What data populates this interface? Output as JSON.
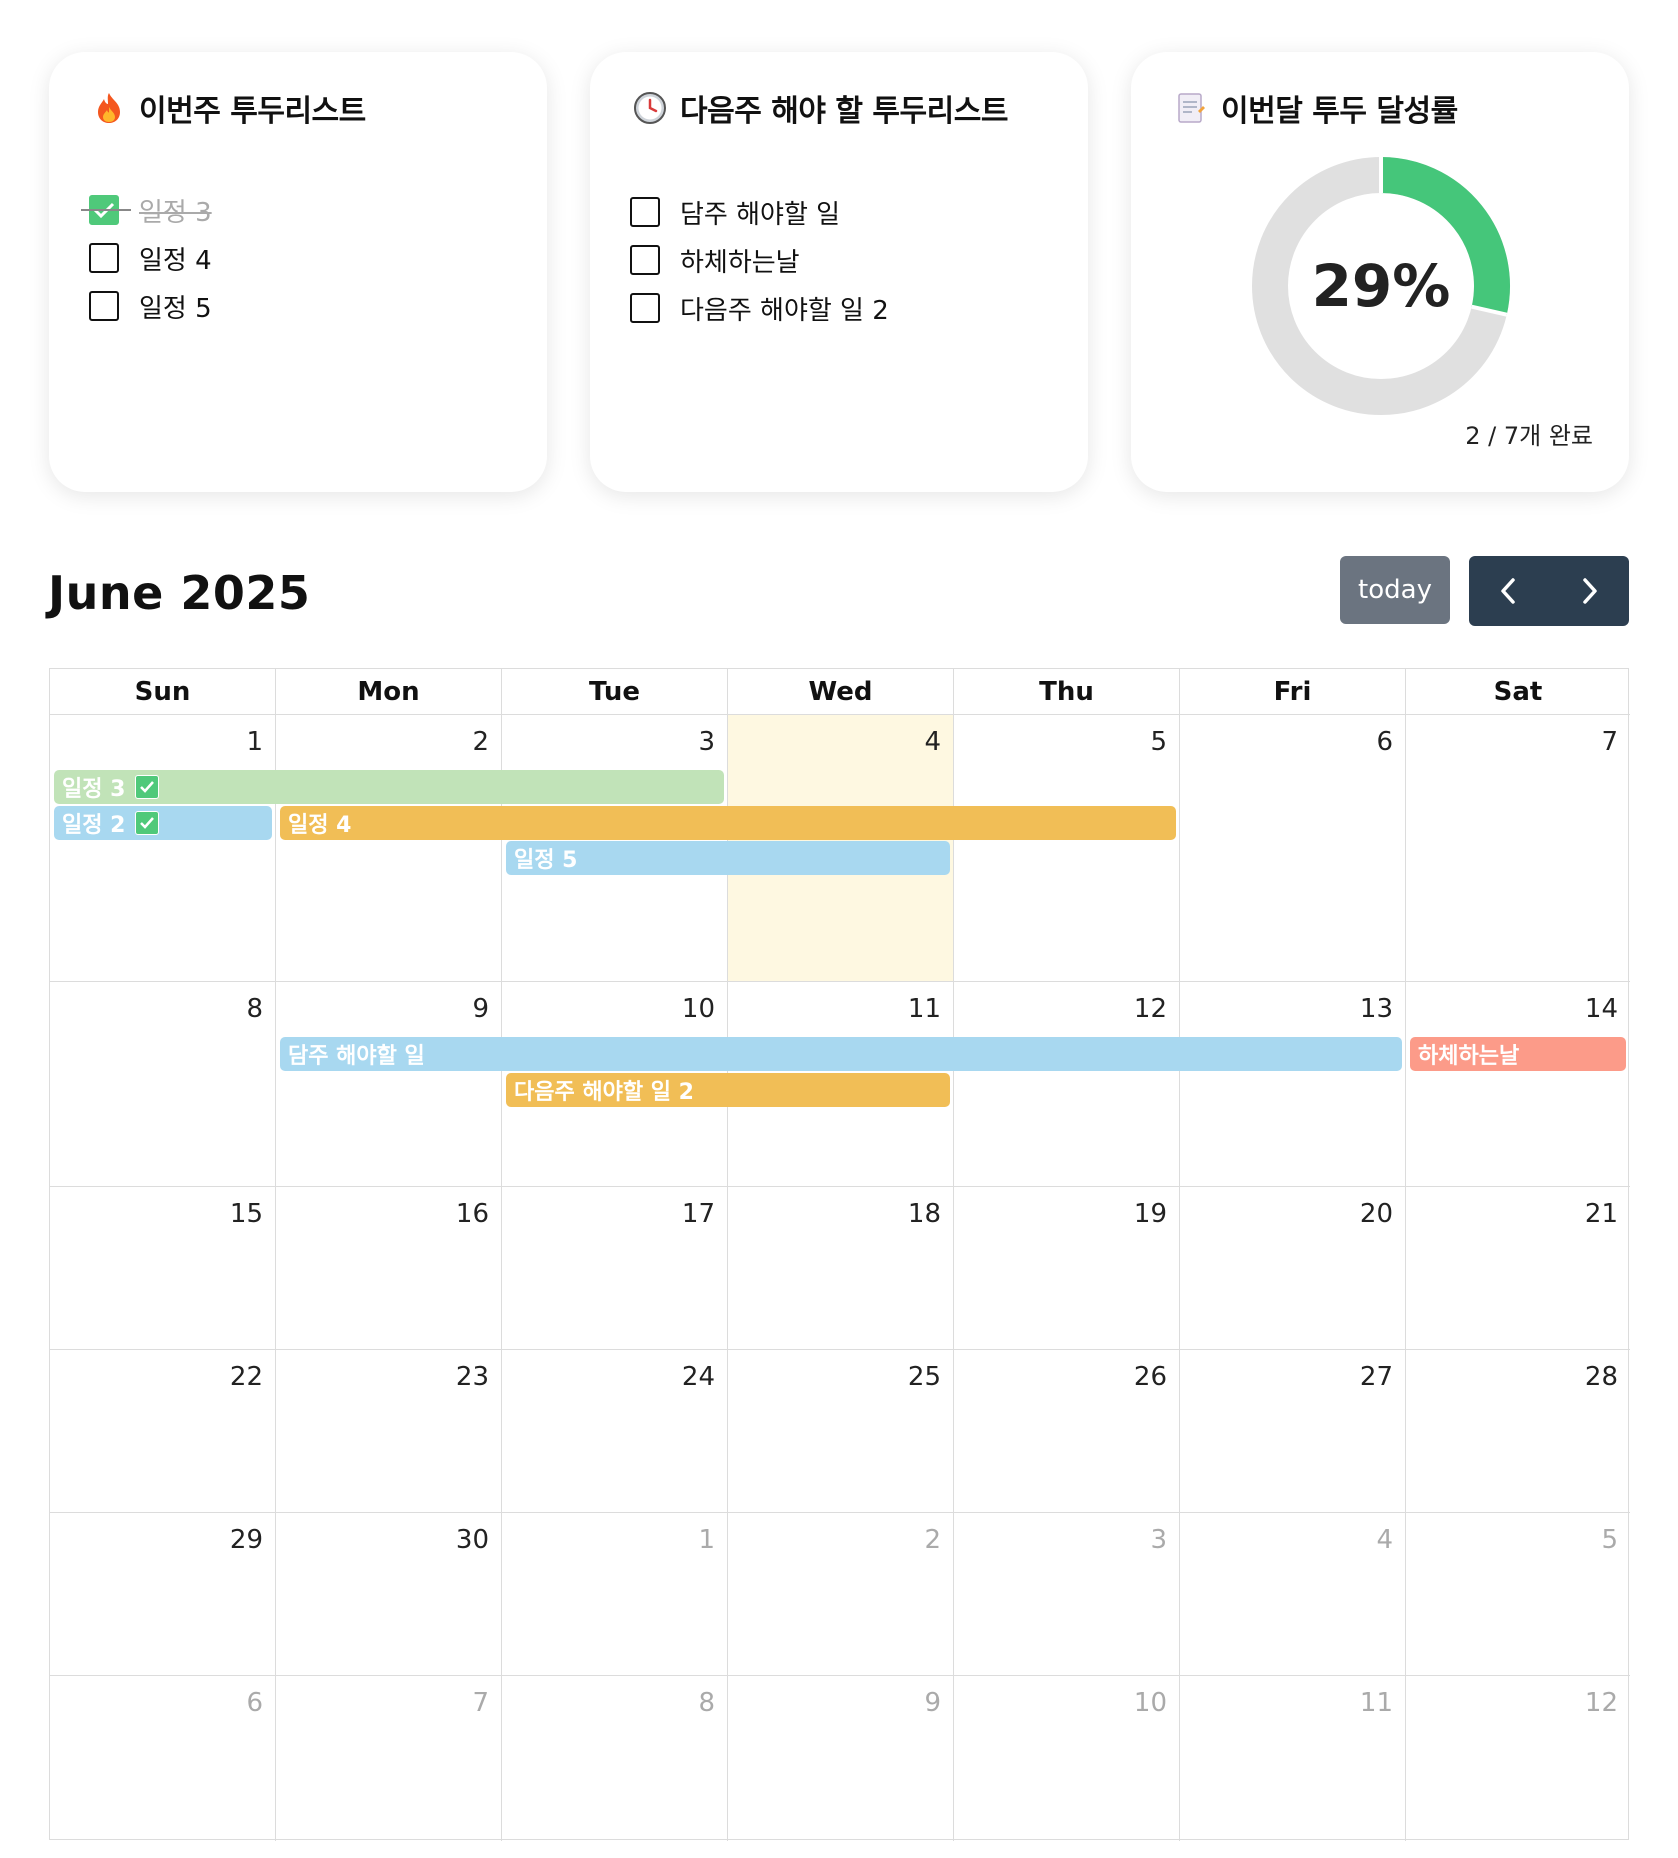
{
  "colors": {
    "card_shadow": "rgba(0,0,0,0.10)",
    "check_green": "#4fc97a",
    "donut_fill": "#45c67a",
    "donut_track": "#e0e0e0",
    "today_bg": "#fef8e1",
    "btn_today": "#6b7480",
    "btn_nav": "#2c3e50",
    "event_green": "#c1e3b8",
    "event_blue": "#a8d8f0",
    "event_orange": "#f1be56",
    "event_salmon": "#fc9b89"
  },
  "cards": {
    "this_week": {
      "icon": "fire-icon",
      "title": "이번주 투두리스트",
      "items": [
        {
          "label": "일정 3",
          "done": true
        },
        {
          "label": "일정 4",
          "done": false
        },
        {
          "label": "일정 5",
          "done": false
        }
      ]
    },
    "next_week": {
      "icon": "clock-icon",
      "title": "다음주 해야 할 투두리스트",
      "items": [
        {
          "label": "담주 해야할 일",
          "done": false
        },
        {
          "label": "하체하는날",
          "done": false
        },
        {
          "label": "다음주 해야할 일 2",
          "done": false
        }
      ]
    },
    "monthly": {
      "icon": "memo-icon",
      "title": "이번달 투두 달성률",
      "percent_label": "29%",
      "progress": 0.2857,
      "caption": "2 / 7개 완료"
    }
  },
  "calendar": {
    "title": "June 2025",
    "today_label": "today",
    "prev_icon": "chevron-left-icon",
    "next_icon": "chevron-right-icon",
    "weekdays": [
      "Sun",
      "Mon",
      "Tue",
      "Wed",
      "Thu",
      "Fri",
      "Sat"
    ],
    "weeks": [
      [
        "1",
        "2",
        "3",
        "4",
        "5",
        "6",
        "7"
      ],
      [
        "8",
        "9",
        "10",
        "11",
        "12",
        "13",
        "14"
      ],
      [
        "15",
        "16",
        "17",
        "18",
        "19",
        "20",
        "21"
      ],
      [
        "22",
        "23",
        "24",
        "25",
        "26",
        "27",
        "28"
      ],
      [
        "29",
        "30",
        "1",
        "2",
        "3",
        "4",
        "5"
      ],
      [
        "6",
        "7",
        "8",
        "9",
        "10",
        "11",
        "12"
      ]
    ],
    "events": [
      {
        "title": "일정 3",
        "completed": true,
        "color": "#c1e3b8"
      },
      {
        "title": "일정 2",
        "completed": true,
        "color": "#a8d8f0"
      },
      {
        "title": "일정 4",
        "completed": false,
        "color": "#f1be56"
      },
      {
        "title": "일정 5",
        "completed": false,
        "color": "#a8d8f0"
      },
      {
        "title": "담주 해야할 일",
        "completed": false,
        "color": "#a8d8f0"
      },
      {
        "title": "하체하는날",
        "completed": false,
        "color": "#fc9b89"
      },
      {
        "title": "다음주 해야할 일 2",
        "completed": false,
        "color": "#f1be56"
      }
    ]
  }
}
